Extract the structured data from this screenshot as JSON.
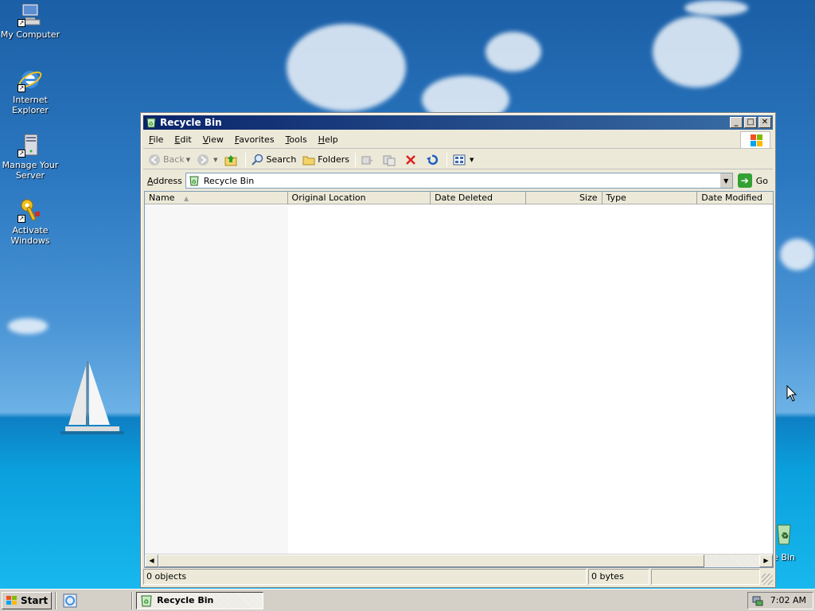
{
  "desktop": {
    "icons": [
      {
        "label_line1": "My Computer",
        "label_line2": ""
      },
      {
        "label_line1": "Internet",
        "label_line2": "Explorer"
      },
      {
        "label_line1": "Manage Your",
        "label_line2": "Server"
      },
      {
        "label_line1": "Activate",
        "label_line2": "Windows"
      }
    ],
    "partial_icon_label": "le Bin"
  },
  "window": {
    "title": "Recycle Bin",
    "caption_buttons": {
      "minimize": "_",
      "maximize": "□",
      "close": "✕"
    },
    "menu": [
      "File",
      "Edit",
      "View",
      "Favorites",
      "Tools",
      "Help"
    ],
    "toolbar": {
      "back_label": "Back",
      "search_label": "Search",
      "folders_label": "Folders"
    },
    "address": {
      "label": "Address",
      "value": "Recycle Bin",
      "go_label": "Go"
    },
    "columns": [
      "Name",
      "Original Location",
      "Date Deleted",
      "Size",
      "Type",
      "Date Modified"
    ],
    "sorted_column": "Name",
    "status": {
      "objects": "0 objects",
      "size": "0 bytes"
    }
  },
  "taskbar": {
    "start_label": "Start",
    "task_buttons": [
      "Recycle Bin"
    ],
    "clock": "7:02 AM"
  },
  "colors": {
    "titlebar_start": "#0a246a",
    "titlebar_end": "#3a6ea5",
    "chrome": "#ece9d8",
    "taskbar": "#d4d0c8"
  }
}
